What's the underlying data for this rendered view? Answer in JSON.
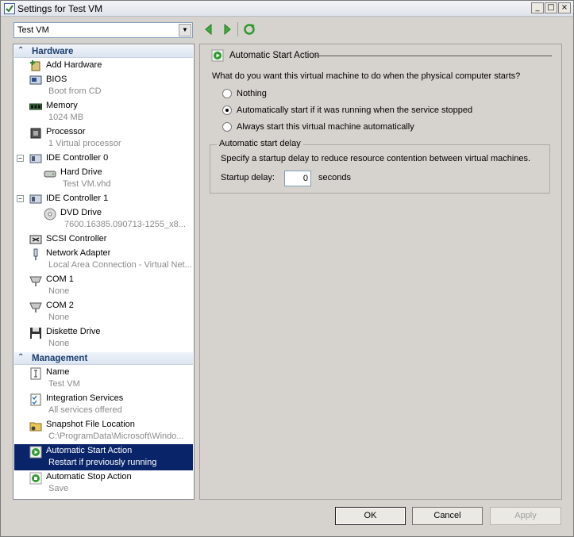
{
  "window": {
    "title": "Settings for Test VM"
  },
  "vm_selector": {
    "value": "Test VM"
  },
  "sidebar": {
    "hardware_header": "Hardware",
    "management_header": "Management",
    "hardware_items": [
      {
        "label": "Add Hardware",
        "sub": ""
      },
      {
        "label": "BIOS",
        "sub": "Boot from CD"
      },
      {
        "label": "Memory",
        "sub": "1024 MB"
      },
      {
        "label": "Processor",
        "sub": "1 Virtual processor"
      },
      {
        "label": "IDE Controller 0",
        "sub": ""
      },
      {
        "label": "Hard Drive",
        "sub": "Test VM.vhd"
      },
      {
        "label": "IDE Controller 1",
        "sub": ""
      },
      {
        "label": "DVD Drive",
        "sub": "7600.16385.090713-1255_x8..."
      },
      {
        "label": "SCSI Controller",
        "sub": ""
      },
      {
        "label": "Network Adapter",
        "sub": "Local Area Connection - Virtual Net..."
      },
      {
        "label": "COM 1",
        "sub": "None"
      },
      {
        "label": "COM 2",
        "sub": "None"
      },
      {
        "label": "Diskette Drive",
        "sub": "None"
      }
    ],
    "management_items": [
      {
        "label": "Name",
        "sub": "Test VM"
      },
      {
        "label": "Integration Services",
        "sub": "All services offered"
      },
      {
        "label": "Snapshot File Location",
        "sub": "C:\\ProgramData\\Microsoft\\Windo..."
      },
      {
        "label": "Automatic Start Action",
        "sub": "Restart if previously running",
        "selected": true
      },
      {
        "label": "Automatic Stop Action",
        "sub": "Save"
      }
    ]
  },
  "panel": {
    "title": "Automatic Start Action",
    "question": "What do you want this virtual machine to do when the physical computer starts?",
    "options": [
      {
        "label": "Nothing",
        "checked": false
      },
      {
        "label": "Automatically start if it was running when the service stopped",
        "checked": true
      },
      {
        "label": "Always start this virtual machine automatically",
        "checked": false
      }
    ],
    "delay_group": {
      "title": "Automatic start delay",
      "description": "Specify a startup delay to reduce resource contention between virtual machines.",
      "delay_label": "Startup delay:",
      "delay_value": "0",
      "delay_units": "seconds"
    }
  },
  "buttons": {
    "ok": "OK",
    "cancel": "Cancel",
    "apply": "Apply"
  }
}
